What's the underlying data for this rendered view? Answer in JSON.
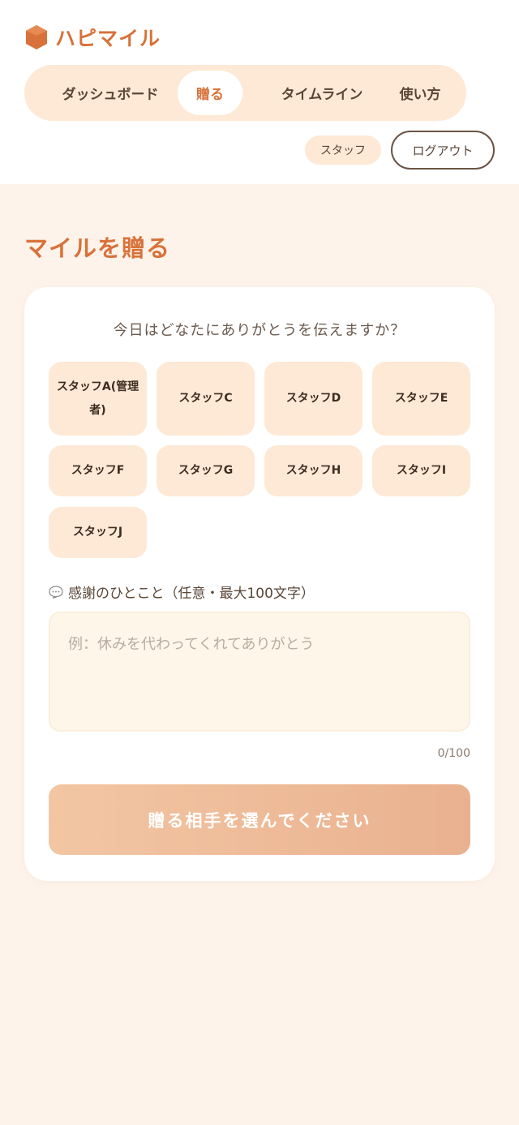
{
  "app": {
    "name": "ハピマイル",
    "logo_icon": "hexagon-logo-icon",
    "brand_color": "#d8723a"
  },
  "nav": {
    "tabs": [
      {
        "label": "ダッシュボード",
        "active": false
      },
      {
        "label": "贈る",
        "active": true
      },
      {
        "label": "タイムライン",
        "active": false
      },
      {
        "label": "使い方",
        "active": false
      }
    ]
  },
  "user": {
    "role": "スタッフ",
    "logout_label": "ログアウト"
  },
  "page": {
    "title": "マイルを贈る"
  },
  "form": {
    "question": "今日はどなたにありがとうを伝えますか？",
    "staff": [
      "スタッフA(管理者)",
      "スタッフC",
      "スタッフD",
      "スタッフE",
      "スタッフF",
      "スタッフG",
      "スタッフH",
      "スタッフI",
      "スタッフJ"
    ],
    "message_icon": "speech-bubble-icon",
    "message_label": "感謝のひとこと（任意・最大100文字）",
    "message_value": "",
    "message_placeholder": "例：休みを代わってくれてありがとう",
    "counter": "0/100",
    "submit_label": "贈る相手を選んでください"
  }
}
